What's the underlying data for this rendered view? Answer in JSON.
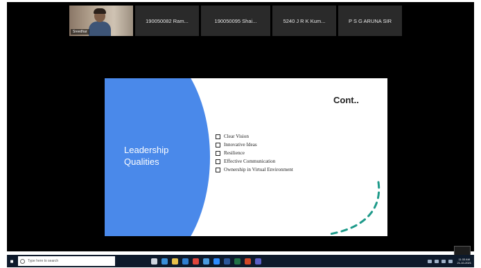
{
  "meeting": {
    "self_video": {
      "name": "Sreedhar"
    },
    "participants": [
      {
        "label": "190050082 Ram..."
      },
      {
        "label": "190050095 Shai..."
      },
      {
        "label": "5240 J R K Kum..."
      },
      {
        "label": "P S G ARUNA SIR"
      }
    ]
  },
  "slide": {
    "left_title_line1": "Leadership",
    "left_title_line2": "Qualities",
    "title": "Cont..",
    "bullets": [
      "Clear Vision",
      "Innovative Ideas",
      "Resilience",
      "Effective Communication",
      "Ownership in Virtual Environment"
    ],
    "accent_color": "#4a89ea",
    "decoration_color": "#1e9a8a"
  },
  "taskbar": {
    "search_placeholder": "Type here to search",
    "app_icons": [
      "task-view-icon",
      "edge-icon",
      "file-explorer-icon",
      "store-icon",
      "chrome-icon",
      "mail-icon",
      "zoom-icon",
      "word-icon",
      "excel-icon",
      "powerpoint-icon",
      "teams-icon"
    ],
    "clock_time": "11:33 AM",
    "clock_date": "21-10-2021"
  }
}
